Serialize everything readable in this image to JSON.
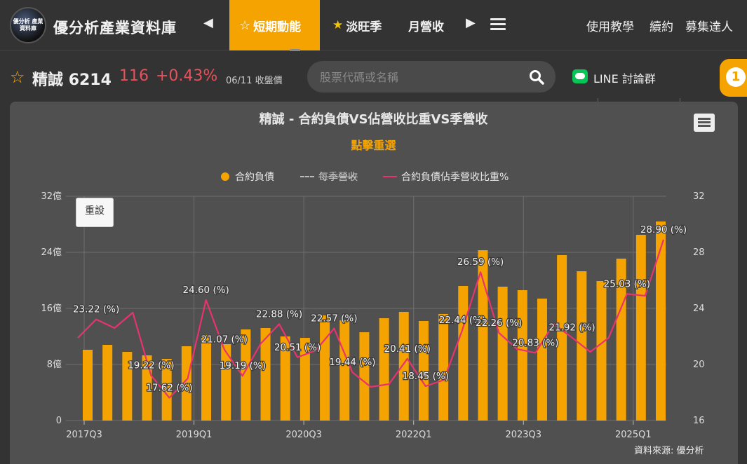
{
  "header": {
    "logo_text": "優分析 產業資料庫",
    "site_title": "優分析產業資料庫",
    "nav": [
      {
        "label": "短期動能"
      },
      {
        "label": "淡旺季"
      },
      {
        "label": "月營收"
      }
    ],
    "right_links": [
      "使用教學",
      "續約",
      "募集達人"
    ]
  },
  "stock": {
    "name": "精誠",
    "code": "6214",
    "price": "116",
    "change": "+0.43%",
    "date": "06/11 收盤價"
  },
  "search": {
    "placeholder": "股票代碼或名稱"
  },
  "line": {
    "label": "LINE 討論群"
  },
  "badge": {
    "count": "1"
  },
  "chart": {
    "title": "精誠 - 合約負債VS佔營收比重VS季營收",
    "subtitle": "點擊重選",
    "reset_label": "重設",
    "legend": [
      "合約負債",
      "每季營收",
      "合約負債佔季營收比重%"
    ],
    "source": "資料來源: 優分析"
  },
  "colors": {
    "bar": "#f5a300",
    "line": "#e8336e",
    "accent": "#f5a300"
  },
  "chart_data": {
    "type": "bar",
    "categories": [
      "2017Q3",
      "2017Q4",
      "2018Q1",
      "2018Q2",
      "2018Q3",
      "2018Q4",
      "2019Q1",
      "2019Q2",
      "2019Q3",
      "2019Q4",
      "2020Q1",
      "2020Q2",
      "2020Q3",
      "2020Q4",
      "2021Q1",
      "2021Q2",
      "2021Q3",
      "2021Q4",
      "2022Q1",
      "2022Q2",
      "2022Q3",
      "2022Q4",
      "2023Q1",
      "2023Q2",
      "2023Q3",
      "2023Q4",
      "2024Q1",
      "2024Q2",
      "2024Q3",
      "2024Q4",
      "2025Q1"
    ],
    "x_tick_labels": [
      "2017Q3",
      "2019Q1",
      "2020Q3",
      "2022Q1",
      "2023Q3",
      "2025Q1"
    ],
    "series": [
      {
        "name": "合約負債",
        "type": "bar",
        "axis": "left",
        "values": [
          10.1,
          10.8,
          9.8,
          9.3,
          8.8,
          10.6,
          12.2,
          10.9,
          13.0,
          13.2,
          12.0,
          11.8,
          15.0,
          14.3,
          12.6,
          14.6,
          15.5,
          14.2,
          15.2,
          19.2,
          24.3,
          19.1,
          18.6,
          17.4,
          23.6,
          21.3,
          19.9,
          23.1,
          26.5,
          28.4
        ]
      },
      {
        "name": "合約負債佔季營收比重%",
        "type": "line",
        "axis": "right",
        "values": [
          21.9,
          23.22,
          22.6,
          23.7,
          19.22,
          17.62,
          19.0,
          24.6,
          21.07,
          19.19,
          21.5,
          22.88,
          20.51,
          21.0,
          22.57,
          19.44,
          18.4,
          18.6,
          20.41,
          18.45,
          18.9,
          22.44,
          26.59,
          22.26,
          21.1,
          20.83,
          22.9,
          21.92,
          20.9,
          21.9,
          25.03,
          24.9,
          28.9
        ]
      }
    ],
    "data_labels": [
      {
        "index": 1,
        "text": "23.22 (%)"
      },
      {
        "index": 4,
        "text": "19.22 (%)"
      },
      {
        "index": 5,
        "text": "17.62 (%)"
      },
      {
        "index": 7,
        "text": "24.60 (%)"
      },
      {
        "index": 8,
        "text": "21.07 (%)"
      },
      {
        "index": 9,
        "text": "19.19 (%)"
      },
      {
        "index": 11,
        "text": "22.88 (%)"
      },
      {
        "index": 12,
        "text": "20.51 (%)"
      },
      {
        "index": 14,
        "text": "22.57 (%)"
      },
      {
        "index": 15,
        "text": "19.44 (%)"
      },
      {
        "index": 18,
        "text": "20.41 (%)"
      },
      {
        "index": 19,
        "text": "18.45 (%)"
      },
      {
        "index": 21,
        "text": "22.44 (%)"
      },
      {
        "index": 22,
        "text": "26.59 (%)"
      },
      {
        "index": 23,
        "text": "22.26 (%)"
      },
      {
        "index": 25,
        "text": "20.83 (%)"
      },
      {
        "index": 27,
        "text": "21.92 (%)"
      },
      {
        "index": 30,
        "text": "25.03 (%)"
      },
      {
        "index": 32,
        "text": "28.90 (%)"
      }
    ],
    "y_left": {
      "ticks": [
        "0",
        "8億",
        "16億",
        "24億",
        "32億"
      ],
      "ylim": [
        0,
        32
      ]
    },
    "y_right": {
      "ticks": [
        "16",
        "20",
        "24",
        "28",
        "32"
      ],
      "ylim": [
        16,
        32
      ]
    },
    "grid": true,
    "legend_position": "top"
  }
}
